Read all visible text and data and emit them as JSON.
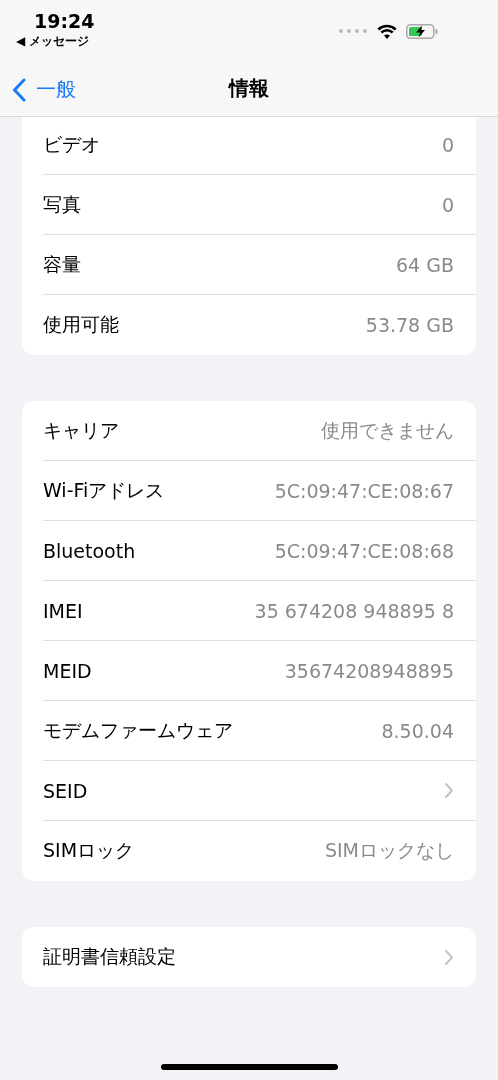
{
  "status_bar": {
    "time": "19:24",
    "back_app": "◀ メッセージ"
  },
  "nav": {
    "back": "一般",
    "title": "情報"
  },
  "groups": [
    {
      "clipped_top": true,
      "rows": [
        {
          "label": "ビデオ",
          "kind": "value",
          "value": "0"
        },
        {
          "label": "写真",
          "kind": "value",
          "value": "0"
        },
        {
          "label": "容量",
          "kind": "value",
          "value": "64 GB"
        },
        {
          "label": "使用可能",
          "kind": "value",
          "value": "53.78 GB"
        }
      ]
    },
    {
      "clipped_top": false,
      "rows": [
        {
          "label": "キャリア",
          "kind": "value",
          "value": "使用できません"
        },
        {
          "label": "Wi-Fiアドレス",
          "kind": "value",
          "value": "5C:09:47:CE:08:67"
        },
        {
          "label": "Bluetooth",
          "kind": "value",
          "value": "5C:09:47:CE:08:68"
        },
        {
          "label": "IMEI",
          "kind": "value",
          "value": "35 674208 948895 8"
        },
        {
          "label": "MEID",
          "kind": "value",
          "value": "35674208948895"
        },
        {
          "label": "モデムファームウェア",
          "kind": "value",
          "value": "8.50.04"
        },
        {
          "label": "SEID",
          "kind": "link"
        },
        {
          "label": "SIMロック",
          "kind": "value",
          "value": "SIMロックなし"
        }
      ]
    },
    {
      "clipped_top": false,
      "rows": [
        {
          "label": "証明書信頼設定",
          "kind": "link"
        }
      ]
    }
  ]
}
